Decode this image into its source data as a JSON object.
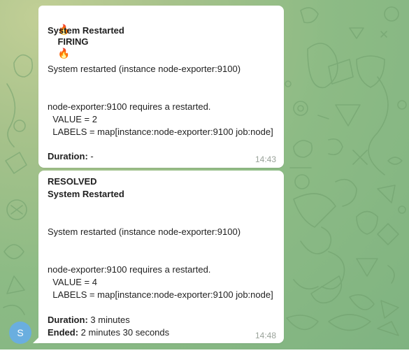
{
  "chat": {
    "avatar": {
      "initial": "S",
      "color": "#6aaedf"
    },
    "messages": [
      {
        "status_emoji_left": "🔥",
        "status": "FIRING",
        "status_emoji_right": "🔥",
        "title": "System Restarted",
        "summary": "System restarted (instance node-exporter:9100)",
        "description": "node-exporter:9100 requires a restarted.",
        "value_line": "  VALUE = 2",
        "labels_line": "  LABELS = map[instance:node-exporter:9100 job:node]",
        "duration_label": "Duration:",
        "duration_value": " -",
        "time": "14:43"
      },
      {
        "status": "RESOLVED",
        "title": "System Restarted",
        "summary": "System restarted (instance node-exporter:9100)",
        "description": "node-exporter:9100 requires a restarted.",
        "value_line": "  VALUE = 4",
        "labels_line": "  LABELS = map[instance:node-exporter:9100 job:node]",
        "duration_label": "Duration:",
        "duration_value": " 3 minutes",
        "ended_label": "Ended:",
        "ended_value": " 2 minutes 30 seconds",
        "time": "14:48"
      }
    ]
  },
  "colors": {
    "chat_background": "#8fb785",
    "bubble": "#ffffff",
    "timestamp": "#9aa39a"
  }
}
